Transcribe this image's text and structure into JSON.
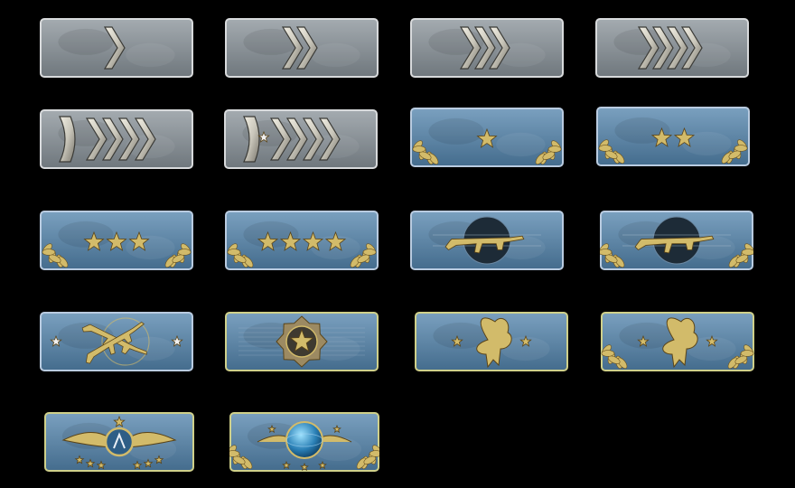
{
  "page": {
    "background": "#000000"
  },
  "colors": {
    "silver_plate": "#8e969c",
    "blue_plate": "#5f86a5",
    "gold": "#d2bb6a",
    "gold_border": "#cfd08a",
    "chevron_metal": "#c9c6ba"
  },
  "badges": [
    {
      "id": "silver-1",
      "plate": "silver",
      "icon": "chevron",
      "count": 1
    },
    {
      "id": "silver-2",
      "plate": "silver",
      "icon": "chevron",
      "count": 2
    },
    {
      "id": "silver-3",
      "plate": "silver",
      "icon": "chevron",
      "count": 3
    },
    {
      "id": "silver-4",
      "plate": "silver",
      "icon": "chevron",
      "count": 4
    },
    {
      "id": "silver-elite",
      "plate": "silver",
      "icon": "bar-chevron",
      "count": 4
    },
    {
      "id": "silver-elite-master",
      "plate": "silver",
      "icon": "bar-star-chevron",
      "count": 4
    },
    {
      "id": "gold-nova-1",
      "plate": "blue",
      "icon": "stars-laurel",
      "count": 1
    },
    {
      "id": "gold-nova-2",
      "plate": "blue",
      "icon": "stars-laurel",
      "count": 2
    },
    {
      "id": "gold-nova-3",
      "plate": "blue",
      "icon": "stars-laurel",
      "count": 3
    },
    {
      "id": "gold-nova-master",
      "plate": "blue",
      "icon": "stars-laurel",
      "count": 4
    },
    {
      "id": "master-guardian-1",
      "plate": "blue",
      "icon": "rifle",
      "count": 1
    },
    {
      "id": "master-guardian-2",
      "plate": "blue",
      "icon": "rifle-laurel",
      "count": 1
    },
    {
      "id": "master-guardian-elite",
      "plate": "blue",
      "icon": "crossed-rifles",
      "count": 2
    },
    {
      "id": "distinguished-master-guardian",
      "plate": "blue-gold",
      "icon": "star-medal",
      "count": 1
    },
    {
      "id": "legendary-eagle",
      "plate": "blue-gold",
      "icon": "eagle",
      "count": 1
    },
    {
      "id": "legendary-eagle-master",
      "plate": "blue-gold",
      "icon": "eagle-laurel",
      "count": 1
    },
    {
      "id": "supreme-master-first-class",
      "plate": "blue-gold",
      "icon": "winged-emblem",
      "count": 1
    },
    {
      "id": "global-elite",
      "plate": "blue-gold",
      "icon": "globe-wings",
      "count": 1
    }
  ]
}
